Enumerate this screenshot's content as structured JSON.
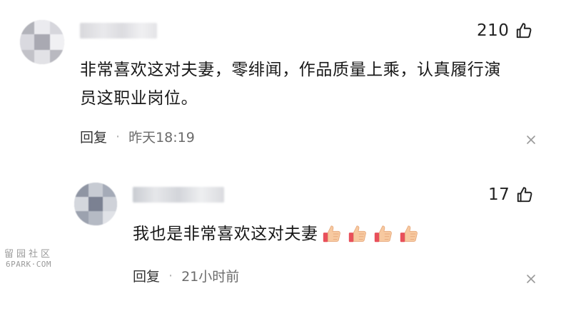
{
  "comments": [
    {
      "likes": "210",
      "text_line1": "非常喜欢这对夫妻，零绯闻，作品质量上乘，认真履行演",
      "text_line2": "员这职业岗位。",
      "reply_label": "回复",
      "time": "昨天18:19"
    },
    {
      "likes": "17",
      "text": "我也是非常喜欢这对夫妻",
      "reply_label": "回复",
      "time": "21小时前",
      "emoji": [
        "thumbs-up",
        "thumbs-up",
        "thumbs-up",
        "thumbs-up"
      ]
    }
  ],
  "separator": "·",
  "watermark": {
    "line1": "留园社区",
    "line2": "6PARK·COM"
  }
}
